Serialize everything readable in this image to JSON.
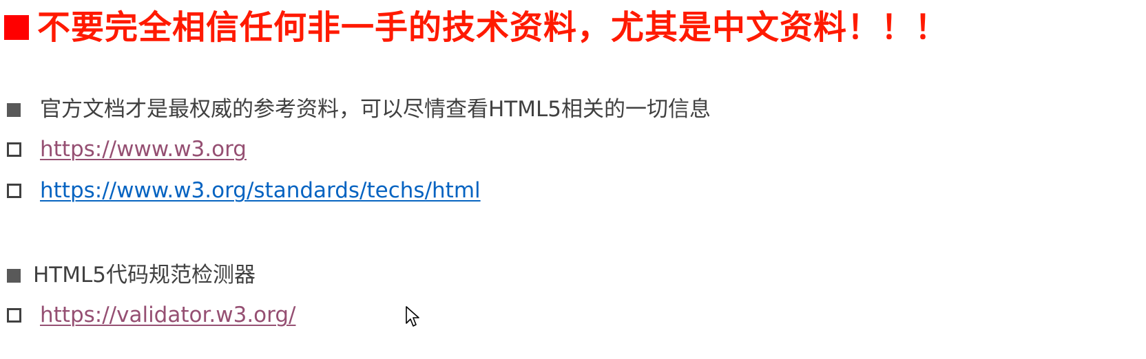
{
  "title": "不要完全相信任何非一手的技术资料，尤其是中文资料！！！",
  "section1": {
    "text": "官方文档才是最权威的参考资料，可以尽情查看HTML5相关的一切信息",
    "links": [
      {
        "text": "https://www.w3.org",
        "state": "visited"
      },
      {
        "text": "https://www.w3.org/standards/techs/html",
        "state": "unvisited"
      }
    ]
  },
  "section2": {
    "text": "HTML5代码规范检测器",
    "links": [
      {
        "text": "https://validator.w3.org/",
        "state": "visited"
      }
    ]
  },
  "colors": {
    "title": "#ff1a00",
    "title_bullet": "#ff0000",
    "body_text": "#404040",
    "visited_link": "#954f72",
    "unvisited_link": "#0563c1"
  },
  "icons": {
    "title_bullet": "filled-square-bullet-icon",
    "text_bullet": "filled-square-bullet-icon",
    "link_bullet": "hollow-square-bullet-icon",
    "cursor": "mouse-pointer-icon"
  }
}
